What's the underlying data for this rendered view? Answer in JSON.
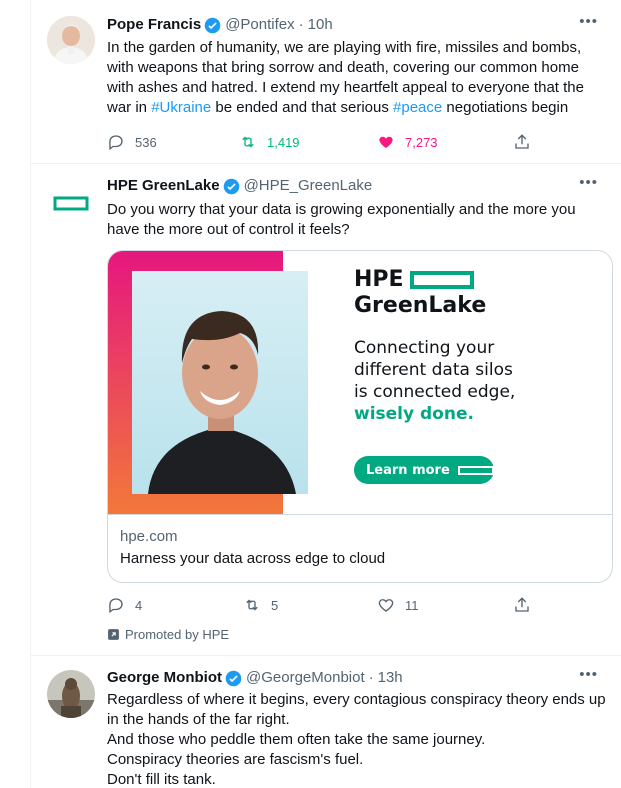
{
  "tweets": [
    {
      "name": "Pope Francis",
      "handle": "@Pontifex",
      "separator": "·",
      "time": "10h",
      "more": "•••",
      "text_parts": {
        "a": "In the garden of humanity, we are playing with fire, missiles and bombs, with weapons that bring sorrow and death, covering our common home with ashes and hatred. I extend my heartfelt appeal to everyone that the war in ",
        "tag1": "#Ukraine",
        "b": " be ended and that serious ",
        "tag2": "#peace",
        "c": " negotiations begin"
      },
      "replies": "536",
      "retweets": "1,419",
      "likes": "7,273"
    },
    {
      "name": "HPE GreenLake",
      "handle": "@HPE_GreenLake",
      "more": "•••",
      "text": "Do you worry that your data is growing exponentially and the more you have the more out of control it feels?",
      "card": {
        "logo_line1": "HPE",
        "logo_line2": "GreenLake",
        "copy_line1": "Connecting your",
        "copy_line2": "different data silos",
        "copy_line3": "is connected edge,",
        "copy_emphasis": "wisely done.",
        "cta": "Learn more",
        "domain": "hpe.com",
        "title": "Harness your data across edge to cloud"
      },
      "replies": "4",
      "retweets": "5",
      "likes": "11",
      "promoted": "Promoted by HPE"
    },
    {
      "name": "George Monbiot",
      "handle": "@GeorgeMonbiot",
      "separator": "·",
      "time": "13h",
      "more": "•••",
      "lines": [
        "Regardless of where it begins, every contagious conspiracy theory ends up in the hands of the far right.",
        "And those who peddle them often take the same journey.",
        "Conspiracy theories are fascism's fuel.",
        "Don't fill its tank."
      ]
    }
  ],
  "colors": {
    "accent": "#1d9bf0",
    "retweet": "#00ba7c",
    "like": "#f91880",
    "hpe_green": "#01a982",
    "muted": "#536471"
  },
  "icons": [
    "verified-icon",
    "reply-icon",
    "retweet-icon",
    "like-icon",
    "share-icon",
    "promoted-icon",
    "more-icon"
  ]
}
